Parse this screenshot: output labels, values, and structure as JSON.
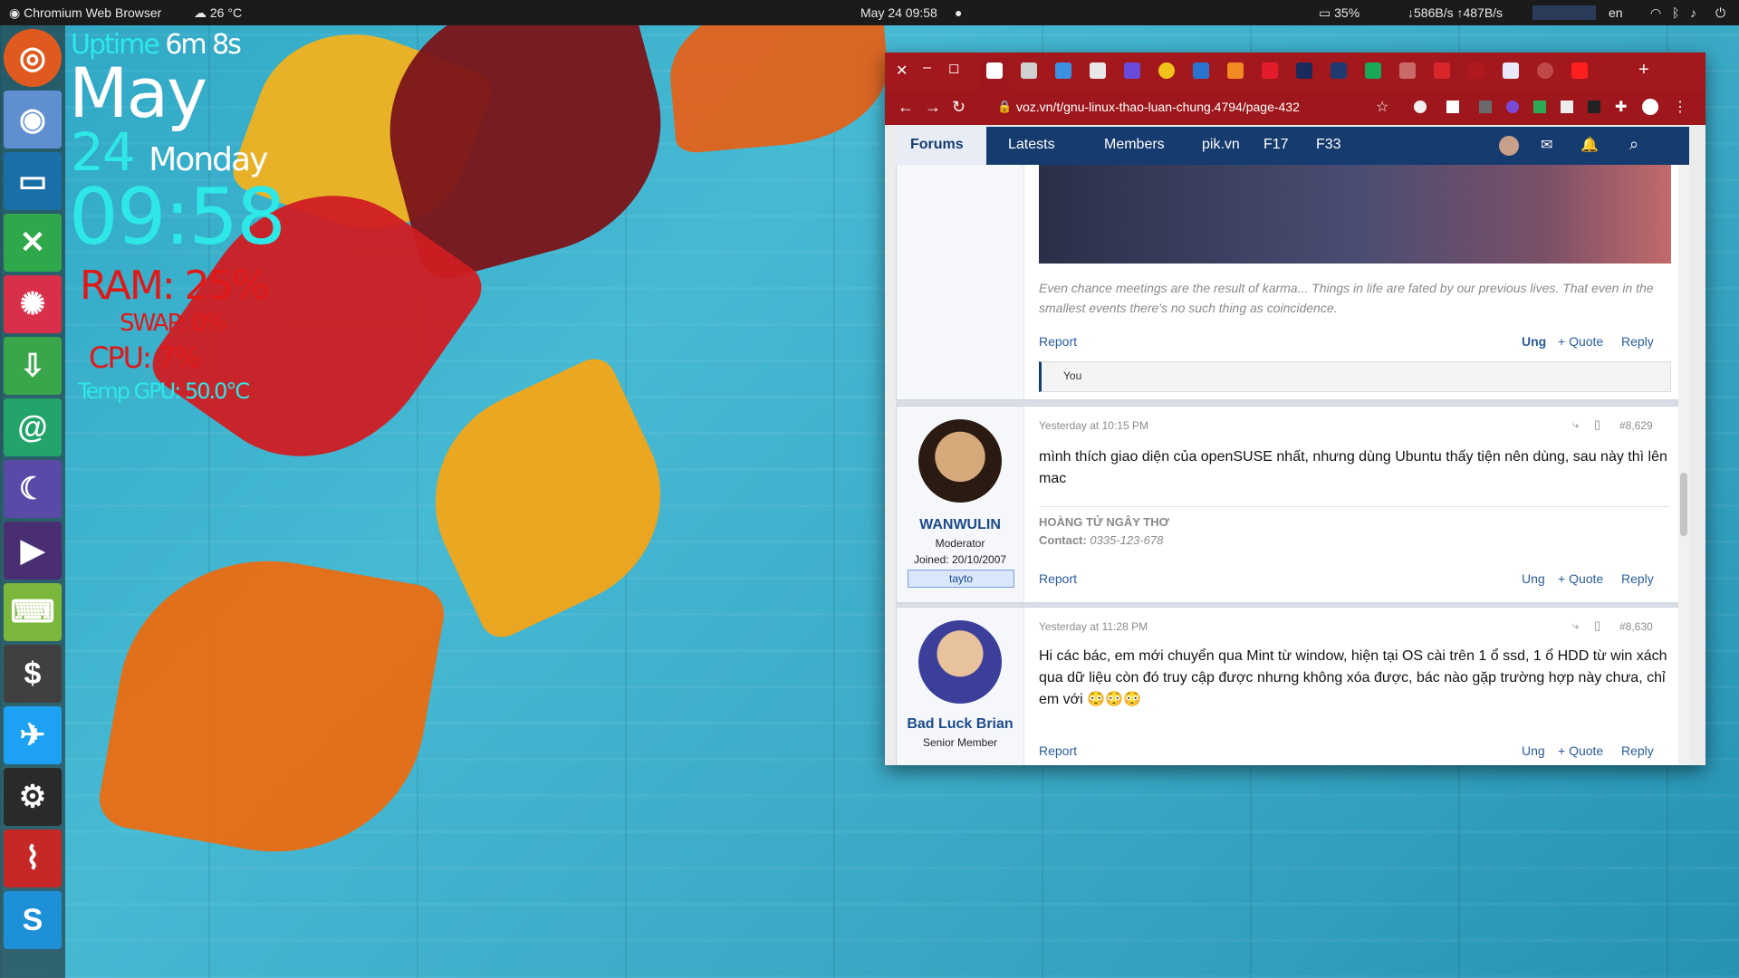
{
  "top_panel": {
    "app_name": "Chromium Web Browser",
    "weather": "26 °C",
    "datetime": "May 24  09:58",
    "battery": "35%",
    "network_speed": "↓586B/s ↑487B/s",
    "keyboard": "en"
  },
  "conky": {
    "uptime_label": "Uptime",
    "uptime_value": "6m 8s",
    "month": "May",
    "day": "24",
    "weekday": "Monday",
    "time": "09:58",
    "ram": "RAM: 25%",
    "swap": "SWAP: 0%",
    "cpu": "CPU: 7%",
    "temp": "Temp GPU: 50.0°C"
  },
  "dock": {
    "items": [
      "ubuntu-icon",
      "chromium-icon",
      "files-icon",
      "crossover-icon",
      "shutter-icon",
      "software-icon",
      "mail-icon",
      "thunderbird-icon",
      "video-icon",
      "games-icon",
      "terminal-icon",
      "twitter-icon",
      "steam-icon",
      "antenna-icon",
      "skype-icon"
    ]
  },
  "browser": {
    "url": "voz.vn/t/gnu-linux-thao-luan-chung.4794/page-432",
    "tab_add": "+",
    "nav": {
      "forums": "Forums",
      "latests": "Latests",
      "members": "Members",
      "pik": "pik.vn",
      "f17": "F17",
      "f33": "F33"
    },
    "posts": [
      {
        "signature": "Even chance meetings are the result of karma... Things in life are fated by our previous lives. That even in the smallest events there's no such thing as coincidence.",
        "report": "Report",
        "react": "Ung",
        "quote": "+ Quote",
        "reply": "Reply",
        "reaction_bar": "You"
      },
      {
        "author": "WANWULIN",
        "role": "Moderator",
        "joined": "Joined: 20/10/2007",
        "badge": "tayto",
        "time": "Yesterday at 10:15 PM",
        "number": "#8,629",
        "body": "mình thích giao diện của openSUSE nhất, nhưng dùng Ubuntu thấy tiện nên dùng, sau này thì lên mac",
        "sig_title": "HOÀNG TỬ NGÂY THƠ",
        "sig_contact_label": "Contact:",
        "sig_contact": "0335-123-678",
        "report": "Report",
        "react": "Ung",
        "quote": "+ Quote",
        "reply": "Reply"
      },
      {
        "author": "Bad Luck Brian",
        "role": "Senior Member",
        "time": "Yesterday at 11:28 PM",
        "number": "#8,630",
        "body": "Hi các bác, em mới chuyển qua Mint từ window, hiện tại OS cài trên 1 ổ ssd, 1 ổ HDD từ win xách qua dữ liệu còn đó truy cập được nhưng không xóa được, bác nào gặp trường hợp này chưa, chỉ em với 😳😳😳",
        "report": "Report",
        "react": "Ung",
        "quote": "+ Quote",
        "reply": "Reply"
      }
    ]
  }
}
